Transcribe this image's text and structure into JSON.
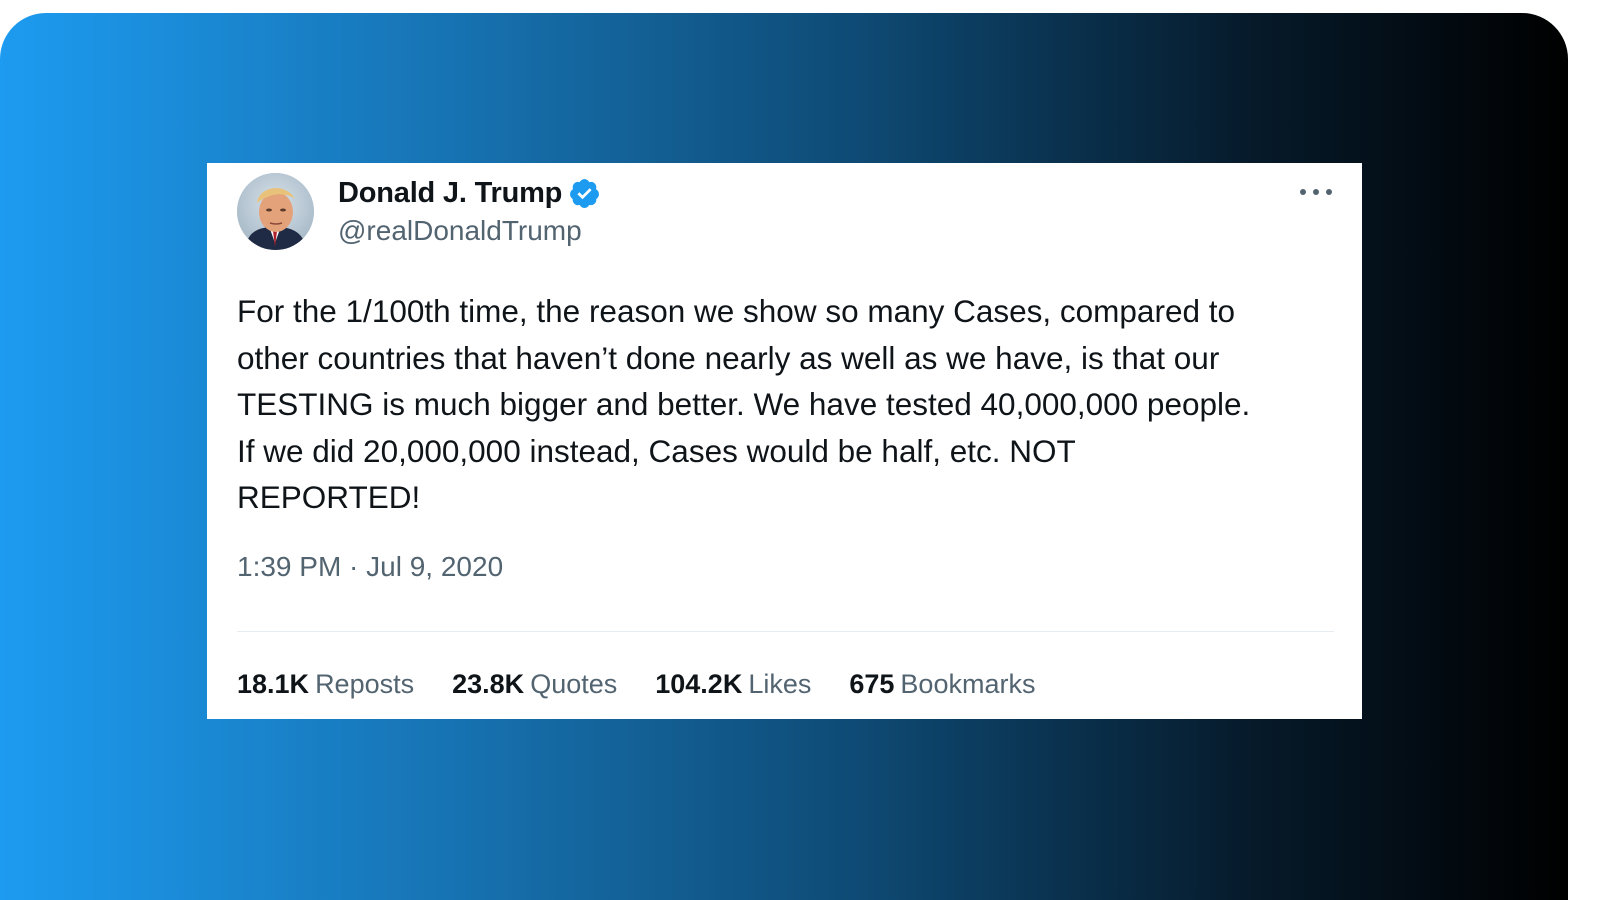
{
  "tweet": {
    "author_name": "Donald J. Trump",
    "handle": "@realDonaldTrump",
    "verified": true,
    "text": "For the 1/100th time, the reason we show so many Cases, compared to\nother countries that haven’t done nearly as well as we have, is that our\nTESTING is much bigger and better. We have tested 40,000,000 people.\nIf we did 20,000,000 instead, Cases would be half, etc. NOT\nREPORTED!",
    "timestamp": "1:39 PM · Jul 9, 2020",
    "stats": [
      {
        "count": "18.1K",
        "label": "Reposts"
      },
      {
        "count": "23.8K",
        "label": "Quotes"
      },
      {
        "count": "104.2K",
        "label": "Likes"
      },
      {
        "count": "675",
        "label": "Bookmarks"
      }
    ],
    "icons": {
      "verified": "verified-badge-icon",
      "more": "more-options-icon"
    }
  },
  "colors": {
    "gradient_start": "#1d9bf0",
    "gradient_end": "#000000",
    "verified_blue": "#1d9bf0",
    "text_primary": "#0f1419",
    "text_secondary": "#536471"
  }
}
